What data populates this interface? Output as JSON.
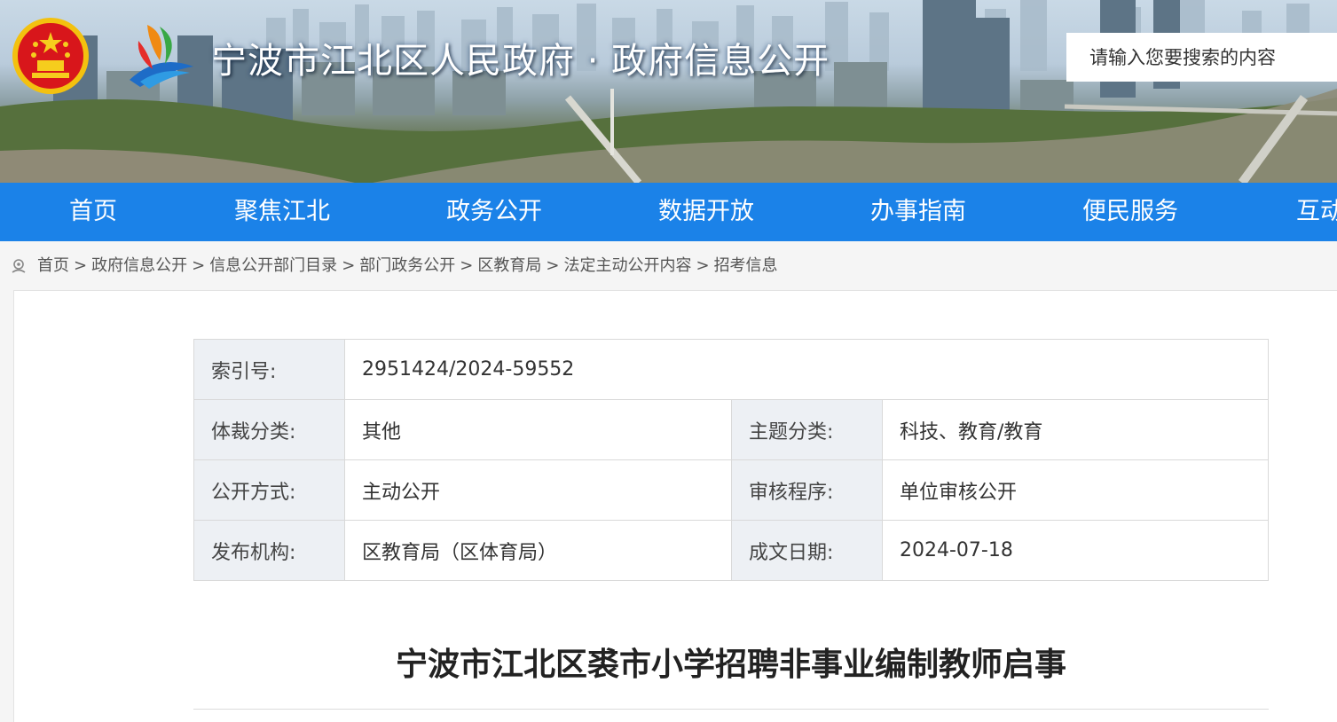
{
  "header": {
    "site_title": "宁波市江北区人民政府 · 政府信息公开",
    "search_placeholder": "请输入您要搜索的内容"
  },
  "nav": {
    "items": [
      "首页",
      "聚焦江北",
      "政务公开",
      "数据开放",
      "办事指南",
      "便民服务",
      "互动"
    ]
  },
  "breadcrumb": {
    "items": [
      "首页",
      "政府信息公开",
      "信息公开部门目录",
      "部门政务公开",
      "区教育局",
      "法定主动公开内容",
      "招考信息"
    ],
    "separator": ">"
  },
  "meta": {
    "index_label": "索引号:",
    "index_value": "2951424/2024-59552",
    "genre_label": "体裁分类:",
    "genre_value": "其他",
    "topic_label": "主题分类:",
    "topic_value": "科技、教育/教育",
    "method_label": "公开方式:",
    "method_value": "主动公开",
    "review_label": "审核程序:",
    "review_value": "单位审核公开",
    "org_label": "发布机构:",
    "org_value": "区教育局（区体育局）",
    "date_label": "成文日期:",
    "date_value": "2024-07-18"
  },
  "document": {
    "title": "宁波市江北区裘市小学招聘非事业编制教师启事"
  },
  "colors": {
    "nav_blue": "#1b82e8",
    "label_bg": "#edf0f4"
  }
}
